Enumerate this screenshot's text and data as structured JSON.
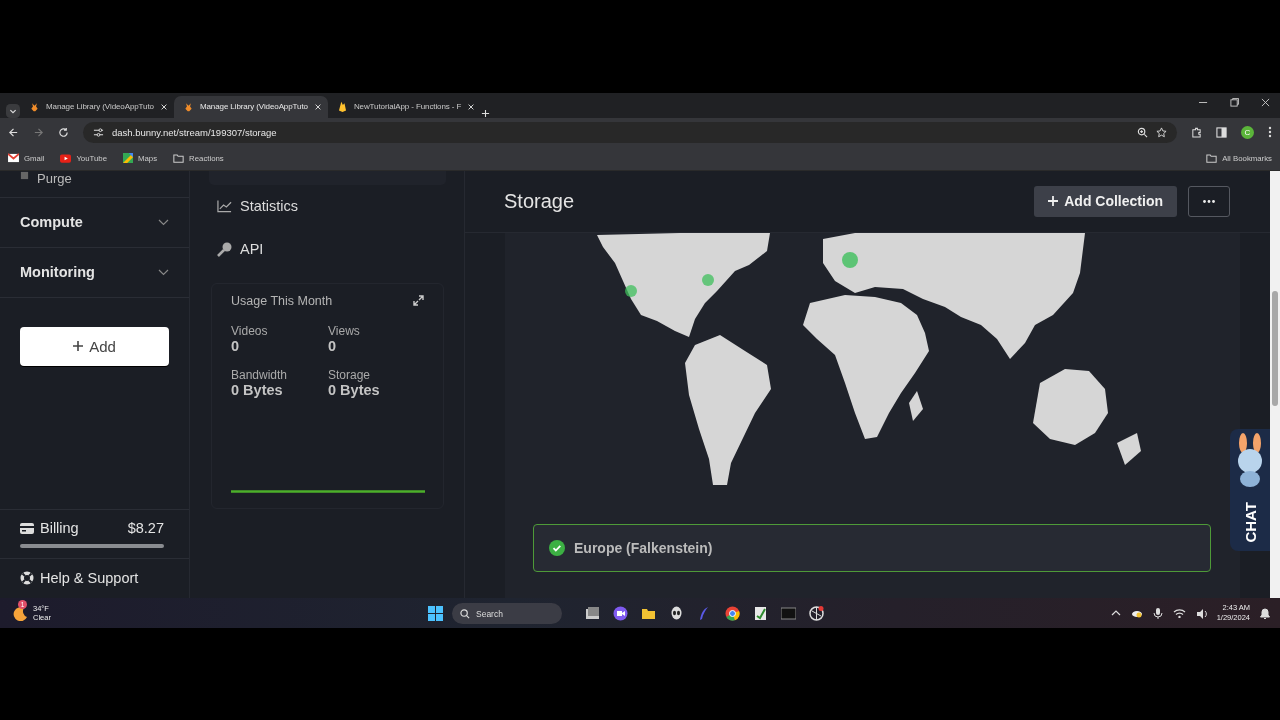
{
  "browser": {
    "tabs": [
      {
        "title": "Manage Library (VideoAppTuto",
        "kind": "bunny",
        "selected": false
      },
      {
        "title": "Manage Library (VideoAppTuto",
        "kind": "bunny",
        "selected": true
      },
      {
        "title": "NewTutorialApp - Functions - F",
        "kind": "firebase",
        "selected": false
      }
    ],
    "url": "dash.bunny.net/stream/199307/storage",
    "profile_initial": "C",
    "bookmarks": [
      {
        "label": "Gmail",
        "kind": "gmail"
      },
      {
        "label": "YouTube",
        "kind": "youtube"
      },
      {
        "label": "Maps",
        "kind": "maps"
      },
      {
        "label": "Reactions",
        "kind": "folder"
      }
    ],
    "all_bookmarks": "All Bookmarks"
  },
  "sidebar": {
    "items": [
      {
        "label": "Purge",
        "kind": "link"
      },
      {
        "label": "Compute",
        "kind": "group",
        "expanded": false
      },
      {
        "label": "Monitoring",
        "kind": "group",
        "expanded": false
      }
    ],
    "add_button": "Add",
    "billing": {
      "label": "Billing",
      "amount": "$8.27"
    },
    "help": "Help & Support"
  },
  "subnav": {
    "items": [
      {
        "label": "Statistics",
        "kind": "chart"
      },
      {
        "label": "API",
        "kind": "key"
      }
    ]
  },
  "usage": {
    "title": "Usage This Month",
    "stats": [
      {
        "label": "Videos",
        "value": "0"
      },
      {
        "label": "Views",
        "value": "0"
      },
      {
        "label": "Bandwidth",
        "value": "0 Bytes"
      },
      {
        "label": "Storage",
        "value": "0 Bytes"
      }
    ]
  },
  "main": {
    "title": "Storage",
    "add_collection": "Add Collection",
    "regions": [
      {
        "name": "Europe (Falkenstein)",
        "selected": true
      }
    ]
  },
  "chat": "CHAT",
  "taskbar": {
    "weather": {
      "badge": "1",
      "temp": "34°F",
      "condition": "Clear"
    },
    "search": "Search",
    "time": "2:43 AM",
    "date": "1/29/2024"
  }
}
